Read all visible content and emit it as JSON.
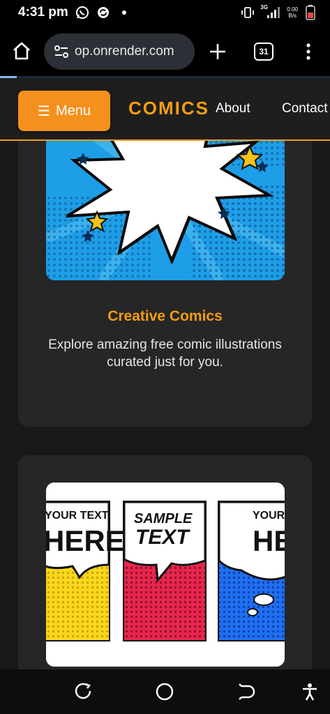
{
  "status_bar": {
    "time": "4:31 pm",
    "network": "3G",
    "speed_value": "0.00",
    "speed_unit": "B/s",
    "icons": [
      "whatsapp-icon",
      "sync-icon",
      "dot-icon",
      "vibrate-icon",
      "signal-icon",
      "battery-icon"
    ]
  },
  "browser": {
    "url": "op.onrender.com",
    "tab_count": "31",
    "load_progress": 0.05,
    "progress_color": "#8ab4f8"
  },
  "site": {
    "menu_label": "Menu",
    "menu_icon": "☰",
    "brand": "COMICS",
    "nav": [
      "About",
      "Contact"
    ],
    "accent_color": "#f39c12",
    "menu_button_color": "#f5901e"
  },
  "cards": [
    {
      "title": "Creative Comics",
      "description": "Explore amazing free comic illustrations curated just for you.",
      "image": "comic-burst-illustration"
    },
    {
      "image": "comic-speech-bubbles-illustration",
      "panels": [
        {
          "text_line1": "YOUR TEXT",
          "text_line2": "HERE"
        },
        {
          "text_line1": "SAMPLE",
          "text_line2": "TEXT"
        },
        {
          "text_line1": "YOUR TE",
          "text_line2": "HER"
        }
      ]
    }
  ],
  "system_nav": [
    "recents-icon",
    "home-circle-icon",
    "back-icon",
    "accessibility-icon"
  ]
}
